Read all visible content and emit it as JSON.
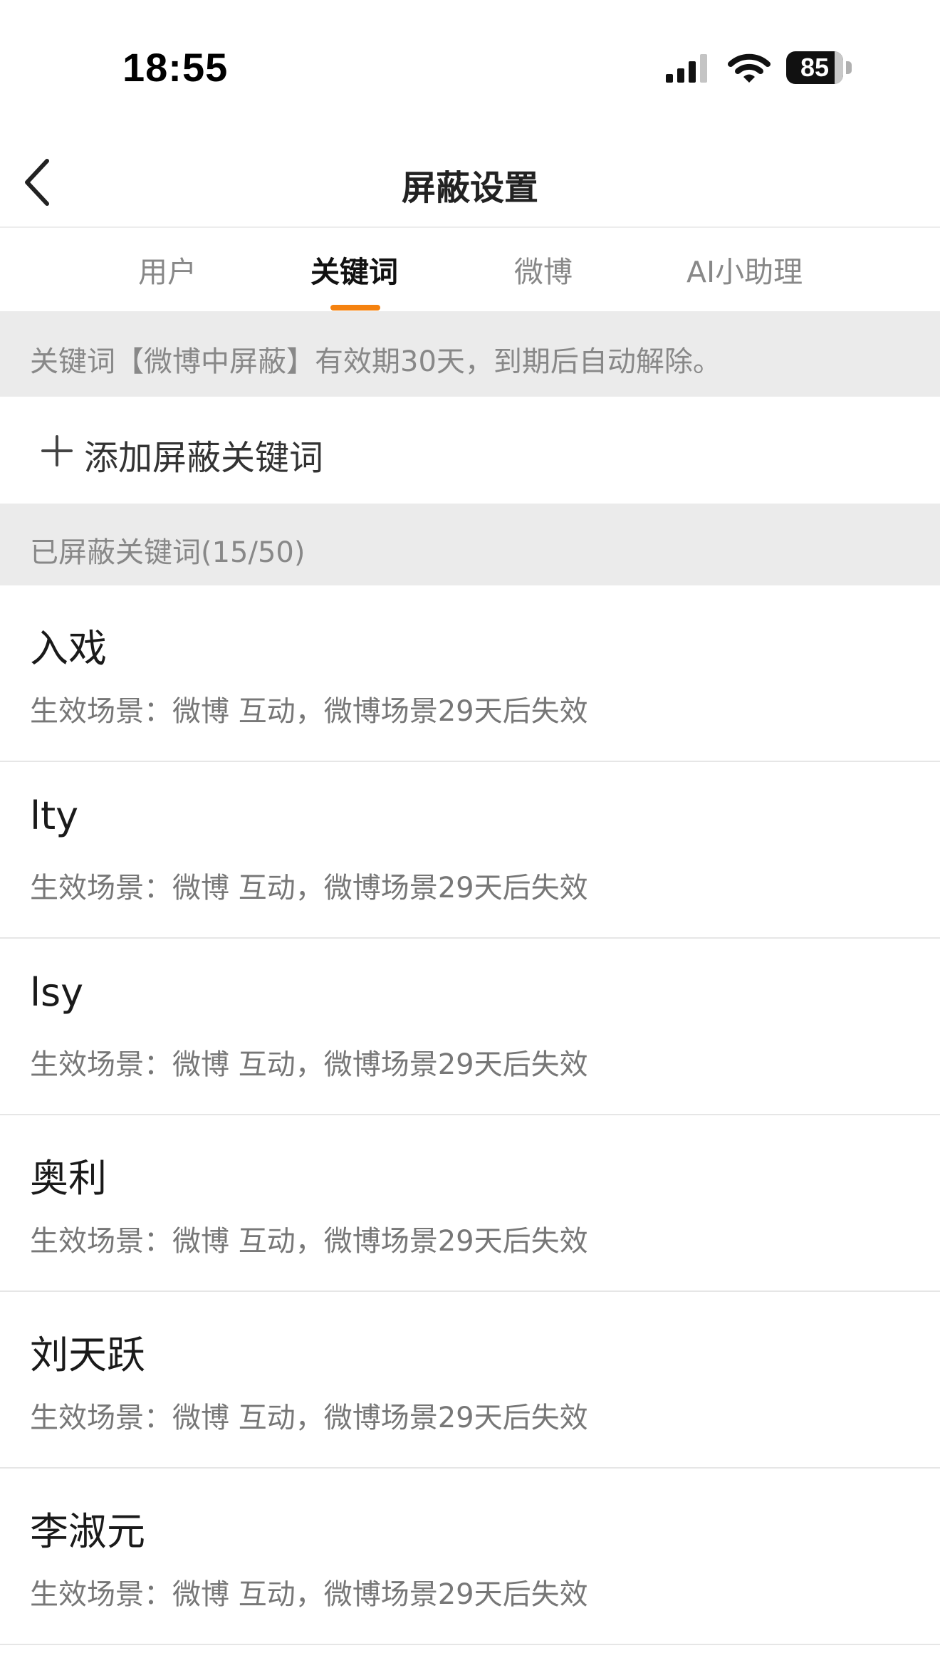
{
  "status_bar": {
    "time": "18:55",
    "battery": "85"
  },
  "nav": {
    "title": "屏蔽设置"
  },
  "tabs": [
    {
      "label": "用户"
    },
    {
      "label": "关键词"
    },
    {
      "label": "微博"
    },
    {
      "label": "AI小助理"
    }
  ],
  "active_tab": "关键词",
  "notice": "关键词【微博中屏蔽】有效期30天，到期后自动解除。",
  "add_button": {
    "label": "添加屏蔽关键词"
  },
  "section": {
    "title": "已屏蔽关键词(15/50)"
  },
  "keywords": [
    {
      "name": "入戏",
      "desc": "生效场景：微博 互动，微博场景29天后失效"
    },
    {
      "name": "lty",
      "desc": "生效场景：微博 互动，微博场景29天后失效"
    },
    {
      "name": "lsy",
      "desc": "生效场景：微博 互动，微博场景29天后失效"
    },
    {
      "name": "奥利",
      "desc": "生效场景：微博 互动，微博场景29天后失效"
    },
    {
      "name": "刘天跃",
      "desc": "生效场景：微博 互动，微博场景29天后失效"
    },
    {
      "name": "李淑元",
      "desc": "生效场景：微博 互动，微博场景29天后失效"
    }
  ],
  "icons": {
    "back": "chevron-left-icon",
    "plus": "plus-icon",
    "signal": "cellular-signal-icon",
    "wifi": "wifi-icon",
    "battery": "battery-icon"
  },
  "colors": {
    "accent": "#f5820f",
    "divider": "#ebebeb",
    "muted_text": "#888888"
  }
}
